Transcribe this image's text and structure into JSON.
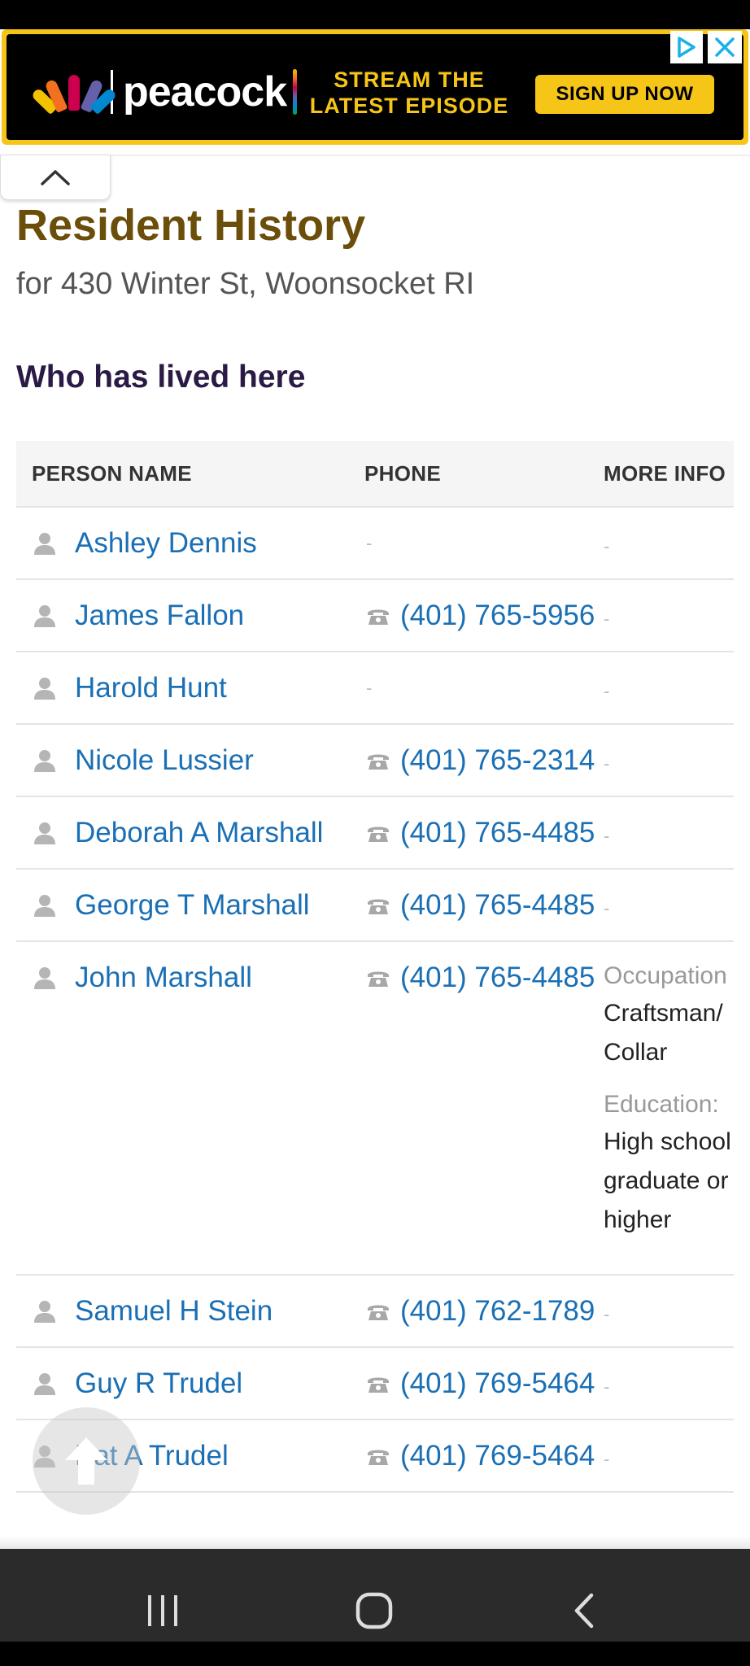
{
  "ad": {
    "brand": "peacock",
    "headline_line1": "STREAM THE",
    "headline_line2": "LATEST EPISODE",
    "cta": "SIGN UP NOW"
  },
  "page": {
    "title": "Resident History",
    "subtitle": "for 430 Winter St, Woonsocket RI",
    "section_title": "Who has lived here"
  },
  "table": {
    "headers": [
      "PERSON NAME",
      "PHONE",
      "MORE INFO"
    ],
    "rows": [
      {
        "name": "Ashley Dennis",
        "phone": "-",
        "info": "-"
      },
      {
        "name": "James Fallon",
        "phone": "(401) 765-5956",
        "info": "-"
      },
      {
        "name": "Harold Hunt",
        "phone": "-",
        "info": "-"
      },
      {
        "name": "Nicole Lussier",
        "phone": "(401) 765-2314",
        "info": "-"
      },
      {
        "name": "Deborah A Marshall",
        "phone": "(401) 765-4485",
        "info": "-"
      },
      {
        "name": "George T Marshall",
        "phone": "(401) 765-4485",
        "info": "-"
      },
      {
        "name": "John Marshall",
        "phone": "(401) 765-4485",
        "info_occupation_label": "Occupation",
        "info_occupation_line1": "Craftsman/",
        "info_occupation_line2": "Collar",
        "info_education_label": "Education:",
        "info_education_line1": "High school",
        "info_education_line2": "graduate or",
        "info_education_line3": "higher"
      },
      {
        "name": "Samuel H Stein",
        "phone": "(401) 762-1789",
        "info": "-"
      },
      {
        "name": "Guy R Trudel",
        "phone": "(401) 769-5464",
        "info": "-"
      },
      {
        "name": "Pat A Trudel",
        "phone": "(401) 769-5464",
        "info": "-"
      }
    ]
  },
  "colors": {
    "title": "#6b4e0a",
    "section_title": "#2a1a45",
    "link": "#1a6fb5",
    "ad_accent": "#f5c518"
  },
  "icons": {
    "person": "person-icon",
    "phone": "phone-icon",
    "collapse": "chevron-up-icon",
    "scroll_top": "arrow-up-icon"
  }
}
